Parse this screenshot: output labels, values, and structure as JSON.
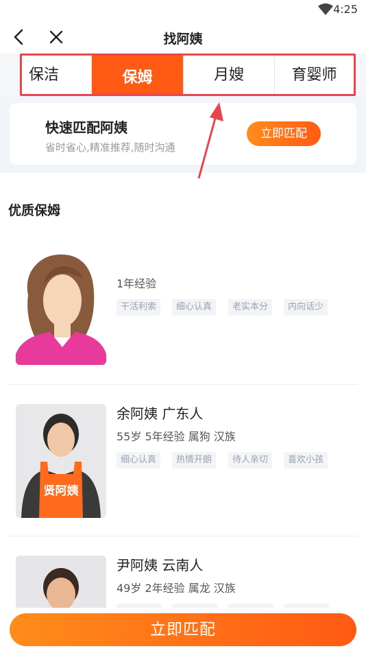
{
  "status_bar": {
    "time": "4:25",
    "icon": "wifi-icon"
  },
  "nav": {
    "title": "找阿姨",
    "back_icon": "back-arrow-icon",
    "close_icon": "close-icon"
  },
  "tabs": [
    {
      "label": "保洁",
      "active": false
    },
    {
      "label": "保姆",
      "active": true
    },
    {
      "label": "月嫂",
      "active": false
    },
    {
      "label": "育婴师",
      "active": false
    }
  ],
  "quick_match": {
    "title": "快速匹配阿姨",
    "subtitle": "省时省心,精准推荐,随时沟通",
    "button": "立即匹配"
  },
  "section_title": "优质保姆",
  "nannies": [
    {
      "name": "",
      "info": "1年经验",
      "tags": [
        "干活利索",
        "细心认真",
        "老实本分",
        "内向话少"
      ]
    },
    {
      "name": "余阿姨  广东人",
      "info": "55岁  5年经验  属狗  汉族",
      "tags": [
        "细心认真",
        "热情开朗",
        "待人亲切",
        "喜欢小孩"
      ],
      "apron_text": "贤阿姨"
    },
    {
      "name": "尹阿姨  云南人",
      "info": "49岁  2年经验  属龙  汉族",
      "tags": [
        "",
        "",
        "",
        ""
      ]
    }
  ],
  "bottom_button": "立即匹配",
  "colors": {
    "accent": "#ff5a14",
    "highlight_border": "#e8454f"
  }
}
